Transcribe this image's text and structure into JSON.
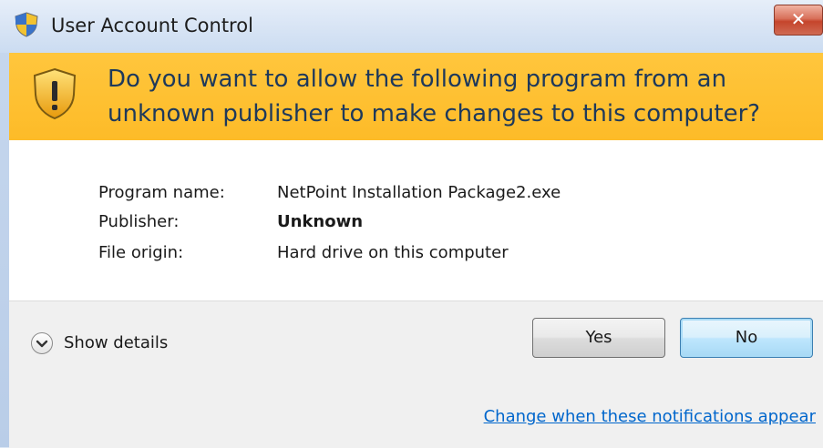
{
  "window": {
    "title": "User Account Control",
    "close_label": "✕"
  },
  "banner": {
    "question": "Do you want to allow the following program from an unknown publisher to make changes to this computer?"
  },
  "details": {
    "rows": [
      {
        "label": "Program name:",
        "value": "NetPoint Installation Package2.exe",
        "bold": false
      },
      {
        "label": "Publisher:",
        "value": "Unknown",
        "bold": true
      },
      {
        "label": "File origin:",
        "value": "Hard drive on this computer",
        "bold": false
      }
    ]
  },
  "actions": {
    "show_details": "Show details",
    "yes": "Yes",
    "no": "No",
    "change_link": "Change when these notifications appear"
  },
  "colors": {
    "banner": "#fdbb28",
    "banner_text": "#1e395b",
    "link": "#0066cc",
    "close": "#c5452c"
  },
  "icons": {
    "title": "uac-shield-icon",
    "banner": "warning-shield-icon",
    "toggle": "chevron-down-icon",
    "close": "close-icon"
  }
}
